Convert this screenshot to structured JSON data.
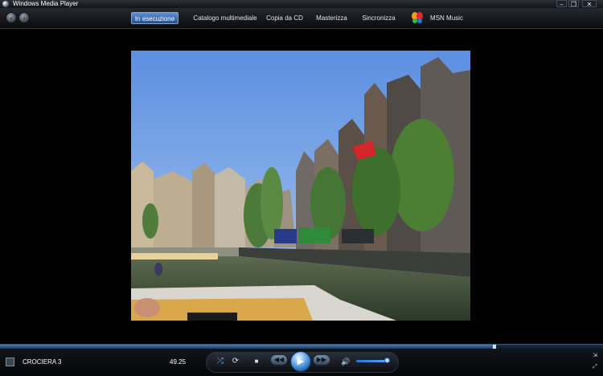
{
  "window": {
    "title": "Windows Media Player",
    "minimize_glyph": "–",
    "restore_glyph": "❐",
    "close_glyph": "✕"
  },
  "nav": {
    "back_glyph": "‹",
    "forward_glyph": "›",
    "tabs": [
      {
        "label": "In esecuzione",
        "active": true
      },
      {
        "label": "Catalogo multimediale",
        "active": false
      },
      {
        "label": "Copia da CD",
        "active": false
      },
      {
        "label": "Masterizza",
        "active": false
      },
      {
        "label": "Sincronizza",
        "active": false
      },
      {
        "label": "MSN Music",
        "active": false
      }
    ]
  },
  "player": {
    "seek_position": 0.82,
    "media_title": "CROCIERA 3",
    "elapsed_time": "49.25",
    "volume_level": 0.85,
    "accent_color": "#3a86e0"
  },
  "controls": {
    "shuffle_glyph": "⤮",
    "repeat_glyph": "⟳",
    "stop_glyph": "■",
    "previous_glyph": "◀◀",
    "play_glyph": "▶",
    "next_glyph": "▶▶",
    "mute_glyph": "🔊",
    "compact_glyph": "⇲",
    "fullscreen_glyph": "⤢"
  }
}
